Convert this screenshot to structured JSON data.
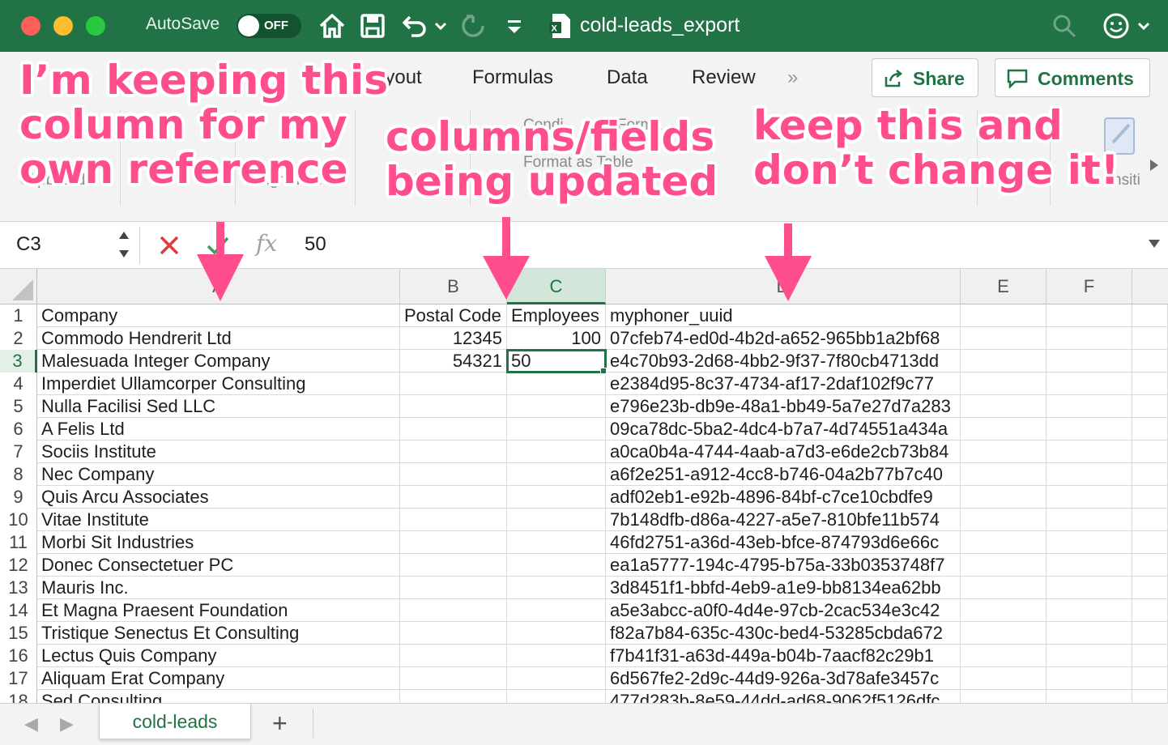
{
  "window": {
    "autosave_label": "AutoSave",
    "autosave_state": "OFF",
    "doc_title": "cold-leads_export"
  },
  "ribbon": {
    "tabs": [
      "ayout",
      "Formulas",
      "Data",
      "Review"
    ],
    "share_label": "Share",
    "comments_label": "Comments",
    "ghost_labels": [
      "Condi",
      "Forma",
      "Format as Table",
      "Clipboard",
      "Fo",
      "Alignment",
      "mbe",
      "nsiti"
    ]
  },
  "formula_bar": {
    "name_box": "C3",
    "value": "50",
    "fx_label": "fx"
  },
  "grid": {
    "columns": [
      {
        "id": "A",
        "label": "A"
      },
      {
        "id": "B",
        "label": "B"
      },
      {
        "id": "C",
        "label": "C"
      },
      {
        "id": "D",
        "label": "D"
      },
      {
        "id": "E",
        "label": "E"
      },
      {
        "id": "F",
        "label": "F"
      }
    ],
    "rows": [
      [
        "1",
        "Company",
        "Postal Code",
        "Employees",
        "myphoner_uuid"
      ],
      [
        "2",
        "Commodo Hendrerit Ltd",
        "12345",
        "100",
        "07cfeb74-ed0d-4b2d-a652-965bb1a2bf68"
      ],
      [
        "3",
        "Malesuada Integer Company",
        "54321",
        "50",
        "e4c70b93-2d68-4bb2-9f37-7f80cb4713dd"
      ],
      [
        "4",
        "Imperdiet Ullamcorper Consulting",
        "",
        "",
        "e2384d95-8c37-4734-af17-2daf102f9c77"
      ],
      [
        "5",
        "Nulla Facilisi Sed LLC",
        "",
        "",
        "e796e23b-db9e-48a1-bb49-5a7e27d7a283"
      ],
      [
        "6",
        "A Felis Ltd",
        "",
        "",
        "09ca78dc-5ba2-4dc4-b7a7-4d74551a434a"
      ],
      [
        "7",
        "Sociis Institute",
        "",
        "",
        "a0ca0b4a-4744-4aab-a7d3-e6de2cb73b84"
      ],
      [
        "8",
        "Nec Company",
        "",
        "",
        "a6f2e251-a912-4cc8-b746-04a2b77b7c40"
      ],
      [
        "9",
        "Quis Arcu Associates",
        "",
        "",
        "adf02eb1-e92b-4896-84bf-c7ce10cbdfe9"
      ],
      [
        "10",
        "Vitae Institute",
        "",
        "",
        "7b148dfb-d86a-4227-a5e7-810bfe11b574"
      ],
      [
        "11",
        "Morbi Sit Industries",
        "",
        "",
        "46fd2751-a36d-43eb-bfce-874793d6e66c"
      ],
      [
        "12",
        "Donec Consectetuer PC",
        "",
        "",
        "ea1a5777-194c-4795-b75a-33b0353748f7"
      ],
      [
        "13",
        "Mauris Inc.",
        "",
        "",
        "3d8451f1-bbfd-4eb9-a1e9-bb8134ea62bb"
      ],
      [
        "14",
        "Et Magna Praesent Foundation",
        "",
        "",
        "a5e3abcc-a0f0-4d4e-97cb-2cac534e3c42"
      ],
      [
        "15",
        "Tristique Senectus Et Consulting",
        "",
        "",
        "f82a7b84-635c-430c-bed4-53285cbda672"
      ],
      [
        "16",
        "Lectus Quis Company",
        "",
        "",
        "f7b41f31-a63d-449a-b04b-7aacf82c29b1"
      ],
      [
        "17",
        "Aliquam Erat Company",
        "",
        "",
        "6d567fe2-2d9c-44d9-926a-3d78afe3457c"
      ],
      [
        "18",
        "Sed Consulting",
        "",
        "",
        "477d283b-8e59-44dd-ad68-9062f5126dfc"
      ]
    ]
  },
  "sheet_tabs": {
    "active": "cold-leads",
    "add_label": "+"
  },
  "annotations": [
    "I’m keeping this\ncolumn for my\nown reference",
    "columns/fields\nbeing updated",
    "keep this and\ndon’t change it!"
  ],
  "colors": {
    "excel_green": "#217346",
    "annotation_pink": "#ff4d8d"
  },
  "icons": [
    "home-icon",
    "save-icon",
    "undo-icon",
    "redo-icon",
    "customize-toolbar-icon",
    "excel-file-icon",
    "search-icon",
    "smiley-feedback-icon",
    "share-icon",
    "comment-icon",
    "cancel-x-icon",
    "confirm-check-icon"
  ]
}
